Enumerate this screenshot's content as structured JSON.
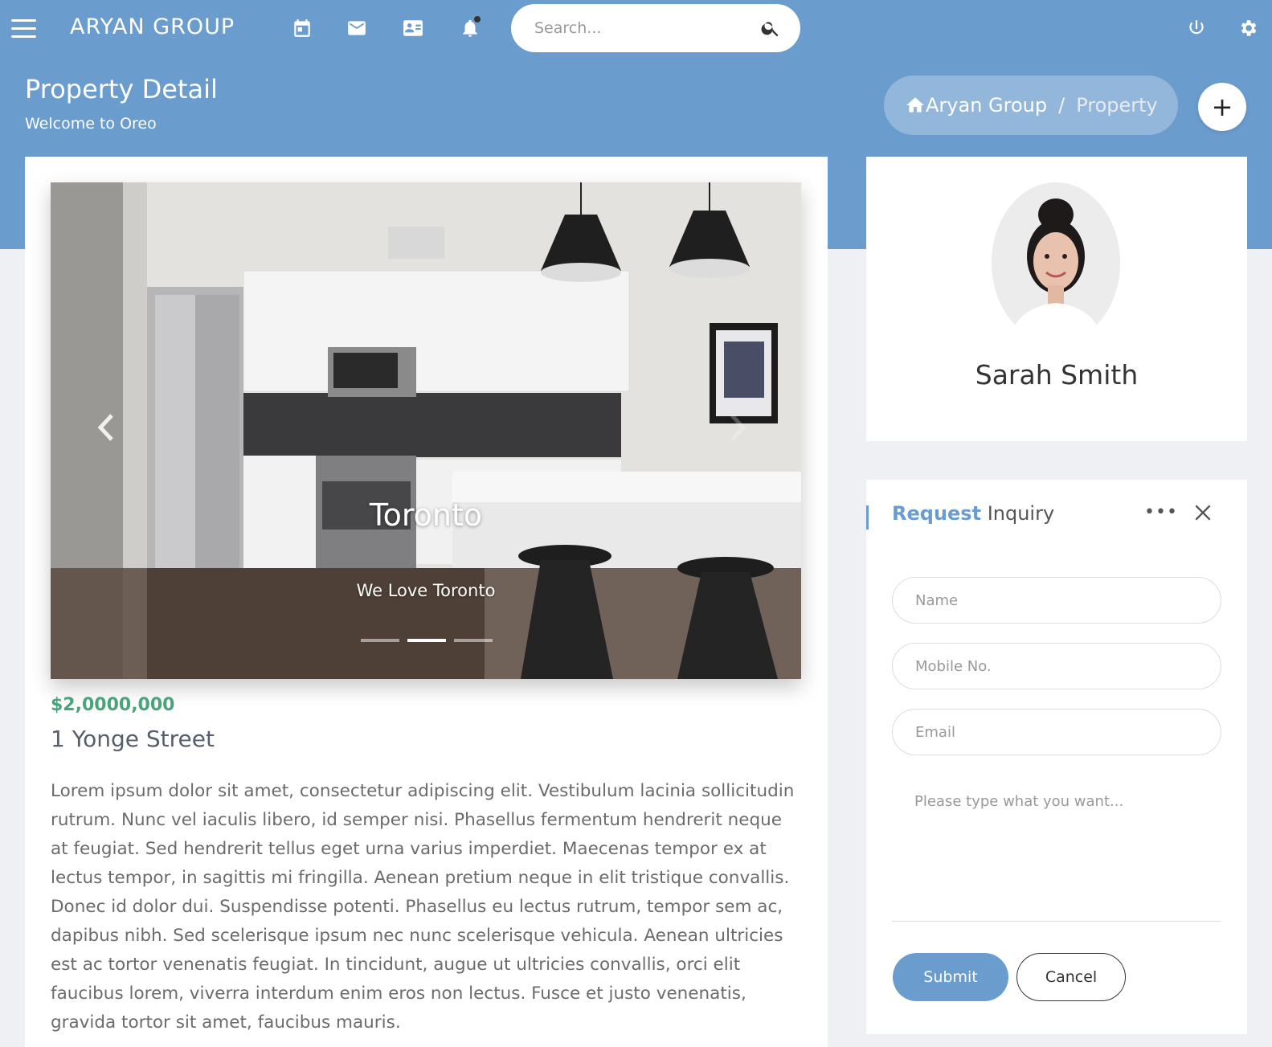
{
  "navbar": {
    "brand": "ARYAN GROUP",
    "icons": [
      "menu-icon",
      "calendar-icon",
      "mail-icon",
      "contact-card-icon",
      "bell-icon"
    ],
    "search_placeholder": "Search...",
    "right_icons": [
      "power-icon",
      "gear-icon"
    ]
  },
  "header": {
    "title": "Property Detail",
    "subtitle": "Welcome to Oreo",
    "breadcrumb": {
      "home": "Aryan Group",
      "separator": "/",
      "current": "Property"
    },
    "add_label": "+"
  },
  "property": {
    "carousel": {
      "title": "Toronto",
      "subtitle": "We Love Toronto",
      "slide_count": 3,
      "active_slide": 2
    },
    "price": "$2,0000,000",
    "address": "1 Yonge Street",
    "description": "Lorem ipsum dolor sit amet, consectetur adipiscing elit. Vestibulum lacinia sollicitudin rutrum. Nunc vel iaculis libero, id semper nisi. Phasellus fermentum hendrerit neque at feugiat. Sed hendrerit tellus eget urna varius imperdiet. Maecenas tempor ex at lectus tempor, in sagittis mi fringilla. Aenean pretium neque in elit tristique convallis. Donec id dolor dui. Suspendisse potenti. Phasellus eu lectus rutrum, tempor sem ac, dapibus nibh. Sed scelerisque ipsum nec nunc scelerisque vehicula. Aenean ultricies est ac tortor venenatis feugiat. In tincidunt, augue ut ultricies convallis, orci elit faucibus lorem, viverra interdum enim eros non lectus. Fusce et justo venenatis, gravida tortor sit amet, faucibus mauris."
  },
  "agent": {
    "name": "Sarah Smith"
  },
  "inquiry": {
    "title_strong": "Request",
    "title_rest": " Inquiry",
    "more_label": "•••",
    "name_placeholder": "Name",
    "mobile_placeholder": "Mobile No.",
    "email_placeholder": "Email",
    "message_placeholder": "Please type what you want...",
    "submit_label": "Submit",
    "cancel_label": "Cancel"
  },
  "colors": {
    "primary": "#6a9cce",
    "price": "#49a37c",
    "background": "#eef0f3"
  }
}
